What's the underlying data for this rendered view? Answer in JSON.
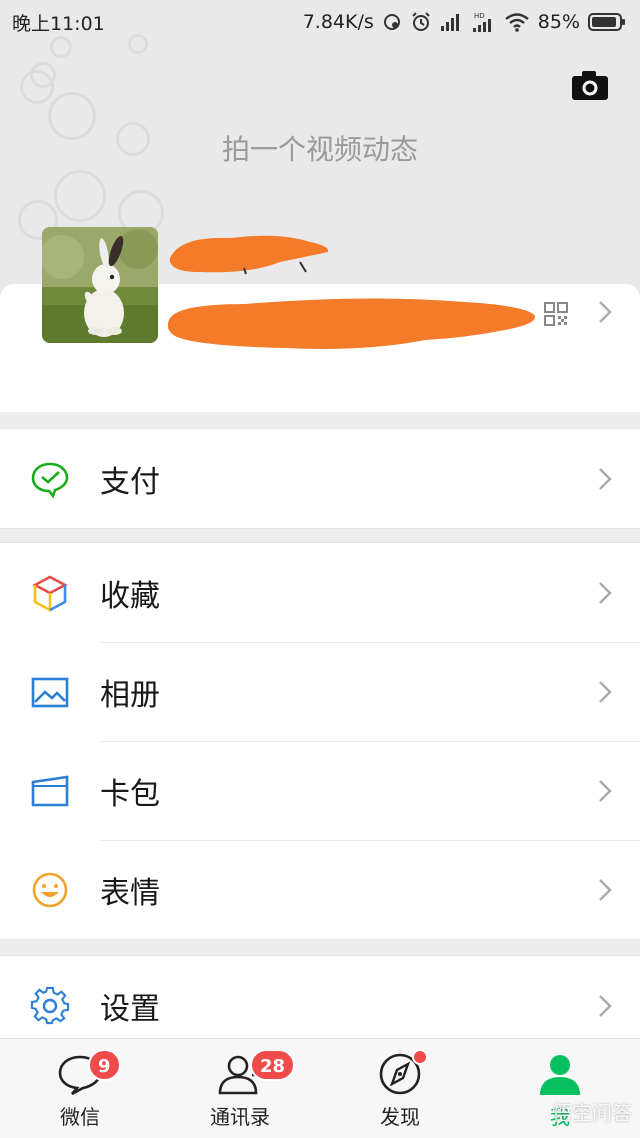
{
  "status_bar": {
    "time": "晚上11:01",
    "net_speed": "7.84K/s",
    "battery": "85%"
  },
  "header": {
    "video_hint": "拍一个视频动态",
    "camera_icon": "camera-icon"
  },
  "profile": {
    "avatar": "rabbit-avatar",
    "qr_icon": "qr-code-icon"
  },
  "menu": {
    "pay": "支付",
    "favorites": "收藏",
    "album": "相册",
    "cards": "卡包",
    "stickers": "表情",
    "settings": "设置"
  },
  "tabbar": {
    "tabs": [
      {
        "label": "微信",
        "badge": "9",
        "icon": "chat-icon"
      },
      {
        "label": "通讯录",
        "badge": "28",
        "icon": "contacts-icon"
      },
      {
        "label": "发现",
        "dot": true,
        "icon": "compass-icon"
      },
      {
        "label": "我",
        "active": true,
        "icon": "me-icon"
      }
    ]
  },
  "watermark": "悟空问答",
  "colors": {
    "accent": "#07c160",
    "badge": "#f04b4b",
    "redaction": "#f47b2a"
  }
}
